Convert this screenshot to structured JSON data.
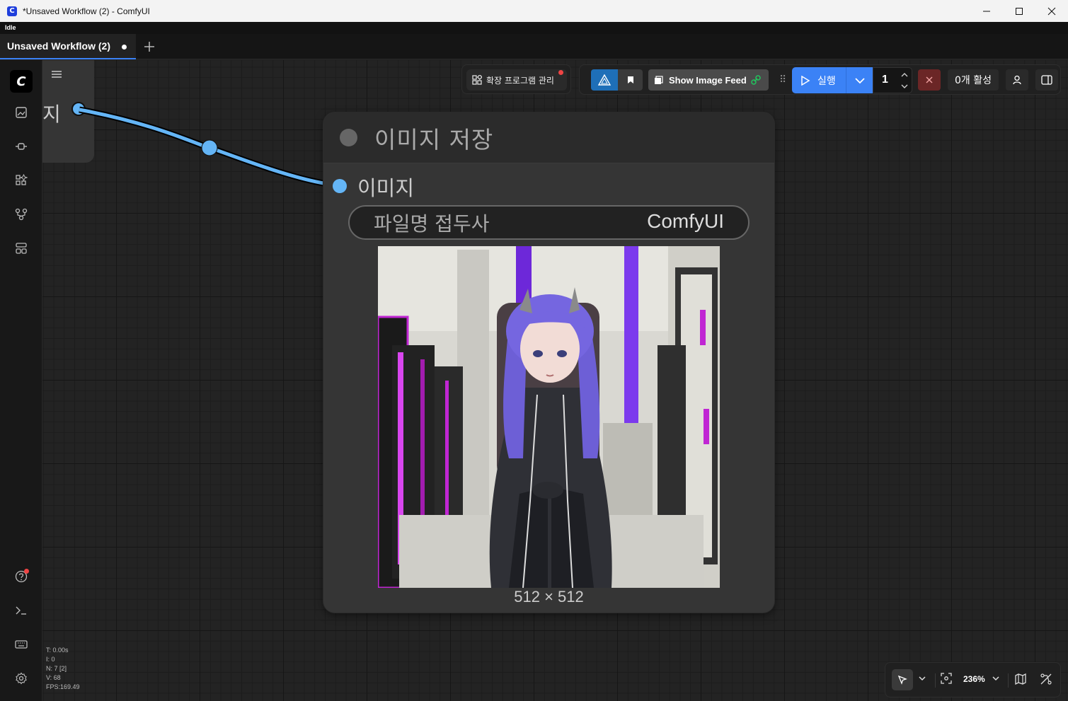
{
  "window": {
    "title": "*Unsaved Workflow (2) - ComfyUI",
    "app_icon_glyph": "C"
  },
  "status": {
    "text": "Idle"
  },
  "tabs": [
    {
      "label": "Unsaved Workflow (2)",
      "active": true,
      "unsaved": true
    }
  ],
  "sidebar": {
    "logo_glyph": "C",
    "items": [
      "images-icon",
      "model-library-icon",
      "node-library-icon",
      "workflows-icon",
      "templates-icon"
    ],
    "bottom": [
      "help-icon",
      "terminal-icon",
      "keyboard-icon",
      "settings-icon"
    ]
  },
  "toolbar": {
    "extensions_label": "확장 프로그램 관리",
    "image_feed_label": "Show Image Feed",
    "run_label": "실행",
    "batch_count": "1",
    "active_queue_label": "0개 활성"
  },
  "partial_node": {
    "output_label": "지"
  },
  "save_node": {
    "title": "이미지 저장",
    "input_label": "이미지",
    "widget_label": "파일명 접두사",
    "widget_value": "ComfyUI",
    "image_size": "512 × 512"
  },
  "stats": {
    "t": "T: 0.00s",
    "i": "I: 0",
    "n": "N: 7 [2]",
    "v": "V: 68",
    "fps": "FPS:169.49"
  },
  "canvas_controls": {
    "zoom": "236%"
  },
  "colors": {
    "accent_blue": "#3b82f6",
    "link_blue": "#64b5f6",
    "cancel_red": "#6b2626",
    "notification_red": "#ef4444"
  }
}
